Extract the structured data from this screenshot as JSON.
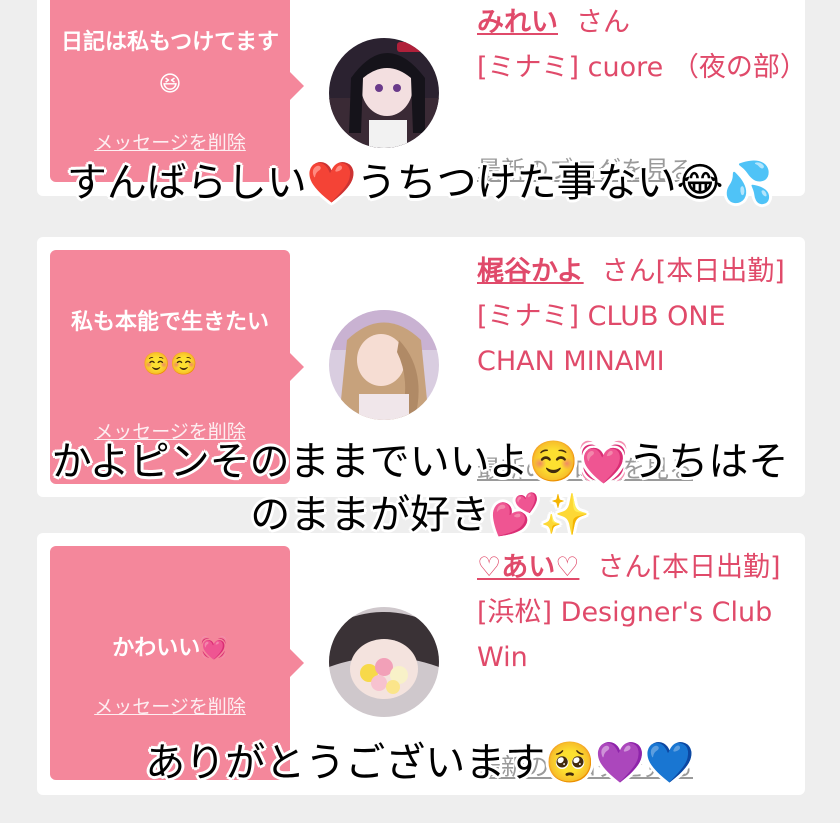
{
  "messages": [
    {
      "bubble_text": "日記は私もつけてます😆",
      "delete_label": "メッセージを削除",
      "name": "みれい",
      "honorific": "さん",
      "shop": "[ミナミ] cuore （夜の部）",
      "blog_link": "最新のブログを見る",
      "overlay": "すんばらしい❤️うちつけた事ない😂💦"
    },
    {
      "bubble_text": "私も本能で生きたい☺️☺️",
      "delete_label": "メッセージを削除",
      "name": "梶谷かよ",
      "honorific": "さん[本日出勤]",
      "shop": "[ミナミ] CLUB ONE CHAN MINAMI",
      "blog_link": "最新のブログを見る",
      "overlay": "かよピンそのままでいいよ☺️💓うちはそ",
      "overlay2": "のままが好き💕✨"
    },
    {
      "bubble_text": "かわいい💓",
      "delete_label": "メッセージを削除",
      "name": "♡あい♡",
      "honorific": "さん[本日出勤]",
      "shop": "[浜松] Designer's Club Win",
      "blog_link": "最新のブログを見る",
      "overlay": "ありがとうございます🥺💜💙"
    }
  ],
  "colors": {
    "page_bg": "#eeeeee",
    "bubble": "#f4879b",
    "accent_text": "#e04a6a",
    "muted_text": "#9a9a9a"
  }
}
